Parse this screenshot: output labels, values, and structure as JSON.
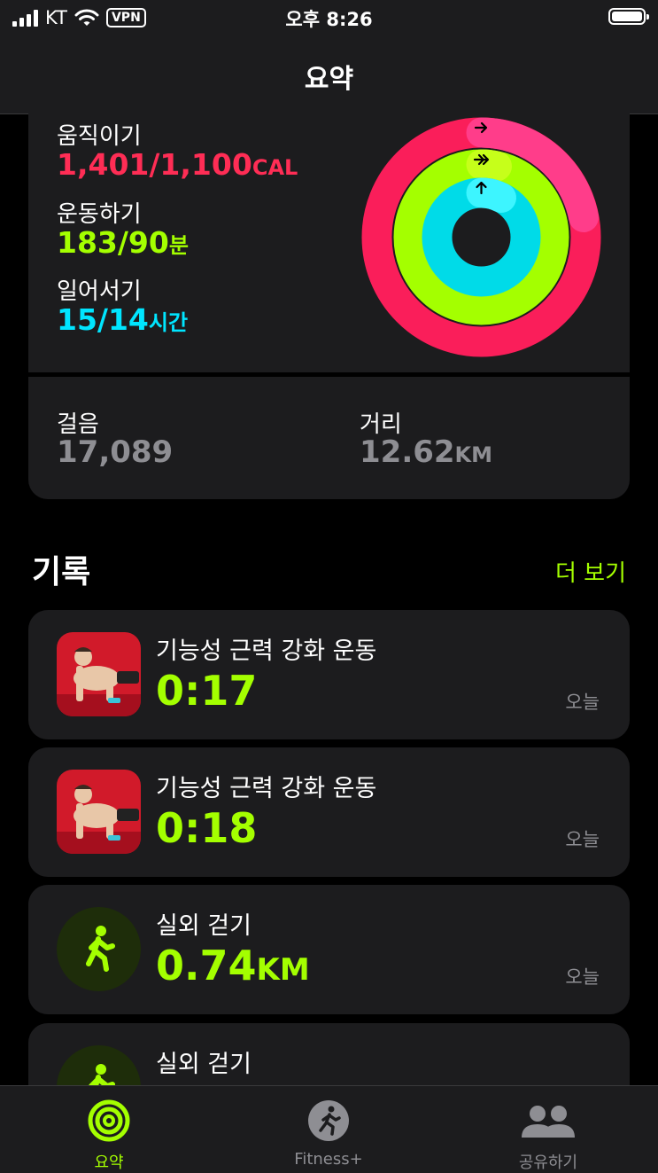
{
  "status_bar": {
    "carrier": "KT",
    "vpn": "VPN",
    "time": "오후 8:26"
  },
  "nav": {
    "title": "요약"
  },
  "activity": {
    "move": {
      "label": "움직이기",
      "value": "1,401/1,100",
      "unit": "CAL",
      "color": "#ff2d55",
      "progress": 1.274
    },
    "exercise": {
      "label": "운동하기",
      "value": "183/90",
      "unit": "분",
      "color": "#a4ff00",
      "progress": 2.033
    },
    "stand": {
      "label": "일어서기",
      "value": "15/14",
      "unit": "시간",
      "color": "#00e5ff",
      "progress": 1.071
    }
  },
  "stats": {
    "steps": {
      "label": "걸음",
      "value": "17,089"
    },
    "distance": {
      "label": "거리",
      "value": "12.62",
      "unit": "KM"
    }
  },
  "history": {
    "title": "기록",
    "more": "더 보기",
    "items": [
      {
        "name": "기능성 근력 강화 운동",
        "value": "0:17",
        "unit": "",
        "date": "오늘",
        "icon": "pushup-app-icon"
      },
      {
        "name": "기능성 근력 강화 운동",
        "value": "0:18",
        "unit": "",
        "date": "오늘",
        "icon": "pushup-app-icon"
      },
      {
        "name": "실외 걷기",
        "value": "0.74",
        "unit": "KM",
        "date": "오늘",
        "icon": "walking-icon"
      },
      {
        "name": "실외 걷기",
        "value": "",
        "unit": "",
        "date": "",
        "icon": "walking-icon"
      }
    ]
  },
  "tabs": [
    {
      "label": "요약",
      "active": true,
      "icon": "activity-rings-icon"
    },
    {
      "label": "Fitness+",
      "active": false,
      "icon": "fitness-plus-icon"
    },
    {
      "label": "공유하기",
      "active": false,
      "icon": "sharing-icon"
    }
  ],
  "colors": {
    "accent": "#a4ff00",
    "move": "#ff2d55",
    "exercise": "#a4ff00",
    "stand": "#00e5ff"
  }
}
